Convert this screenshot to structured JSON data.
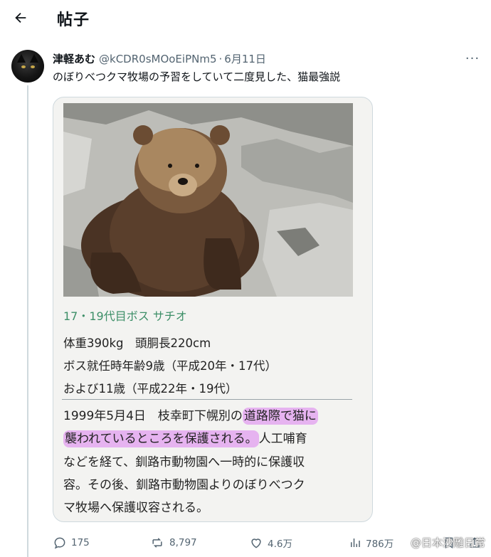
{
  "header": {
    "back_icon": "arrow-left-icon",
    "title": "帖子"
  },
  "post": {
    "display_name": "津軽あむ",
    "handle": "@kCDR0sMOoEiPNm5",
    "dot": "·",
    "date": "6月11日",
    "more_icon": "more-horizontal-icon",
    "more_label": "···",
    "text": "のぼりべつクマ牧場の予習をしていて二度見した、猫最強説"
  },
  "card": {
    "photo_subject": "brown-bear-photo",
    "caption_title": "17・19代目ボス サチオ",
    "stats": [
      "体重390kg　頭胴長220cm",
      "ボス就任時年齢9歳（平成20年・17代）",
      "および11歳（平成22年・19代）"
    ],
    "body": {
      "line1_plain": "1999年5月4日　枝幸町下幌別の",
      "line1_highlight": "道路際で猫に",
      "line2_highlight": "襲われているところを保護される。",
      "line2_plain": "人工哺育",
      "line3": "などを経て、釧路市動物園へ一時的に保護収",
      "line4": "容。その後、釧路市動物園よりのぼりべつク",
      "line5": "マ牧場へ保護収容される。"
    },
    "highlight_color": "#e6b3f0"
  },
  "actions": {
    "replies": "175",
    "reposts": "8,797",
    "likes": "4.6万",
    "views": "786万"
  },
  "watermark": "@日本沙雕日常",
  "colors": {
    "text": "#0f1419",
    "secondary": "#536471",
    "caption_green": "#3d8f68",
    "border": "#cfd9de"
  }
}
